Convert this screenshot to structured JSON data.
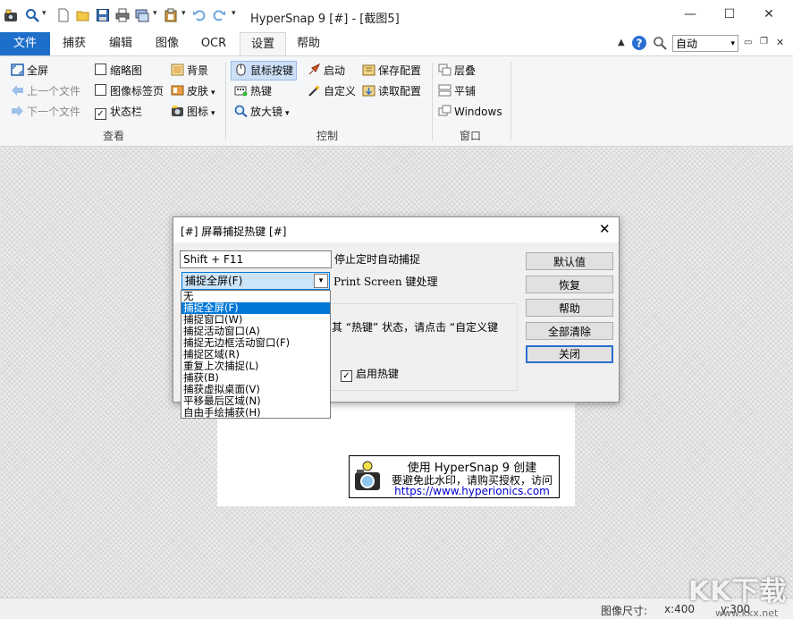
{
  "window": {
    "title": "HyperSnap 9 [#] - [截图5]",
    "min": "—",
    "max": "☐",
    "close": "✕"
  },
  "tabs": [
    {
      "label": "文件"
    },
    {
      "label": "捕获"
    },
    {
      "label": "编辑"
    },
    {
      "label": "图像"
    },
    {
      "label": "OCR"
    },
    {
      "label": "设置"
    },
    {
      "label": "帮助"
    }
  ],
  "toolbar_right": {
    "zoom_value": "自动"
  },
  "ribbon": {
    "view": {
      "fullscreen": "全屏",
      "prev_file": "上一个文件",
      "next_file": "下一个文件",
      "thumbnail": "缩略图",
      "image_tabs": "图像标签页",
      "statusbar": "状态栏",
      "background": "背景",
      "skin": "皮肤",
      "icons": "图标",
      "group_label": "查看"
    },
    "control": {
      "mouse_buttons": "鼠标按键",
      "hotkeys": "热键",
      "magnifier": "放大镜",
      "startup": "启动",
      "customize": "自定义",
      "save_config": "保存配置",
      "load_config": "读取配置",
      "group_label": "控制"
    },
    "window": {
      "cascade": "层叠",
      "tile": "平铺",
      "windows": "Windows",
      "group_label": "窗口"
    }
  },
  "dialog": {
    "title": "[#] 屏幕捕捉热键 [#]",
    "close": "✕",
    "hotkey_value": "Shift + F11",
    "hotkey_desc": "停止定时自动捕捉",
    "combo_value": "捕捉全屏(F)",
    "printscreen_desc": "Print Screen 键处理",
    "info_text": "其 “热键” 状态，请点击 “自定义键",
    "enable_hotkeys": "启用热键",
    "options": [
      "无",
      "捕捉全屏(F)",
      "捕捉窗口(W)",
      "捕捉活动窗口(A)",
      "捕捉无边框活动窗口(F)",
      "捕捉区域(R)",
      "重复上次捕捉(L)",
      "捕获(B)",
      "捕获虚拟桌面(V)",
      "平移最后区域(N)",
      "自由手绘捕获(H)"
    ],
    "selected_index": 1,
    "buttons": {
      "default": "默认值",
      "restore": "恢复",
      "help": "帮助",
      "clear_all": "全部清除",
      "close": "关闭"
    }
  },
  "watermark": {
    "line1": "使用 HyperSnap 9 创建",
    "line2": "要避免此水印，请购买授权，访问",
    "url": "https://www.hyperionics.com"
  },
  "status": {
    "image_size_label": "图像尺寸:",
    "width": "x:400",
    "height": "y:300"
  },
  "brand_watermark": "KK下载",
  "brand_url": "www.kkx.net",
  "colors": {
    "file_tab": "#1e6fc9",
    "selection": "#0078d7",
    "link": "#0000cc"
  }
}
